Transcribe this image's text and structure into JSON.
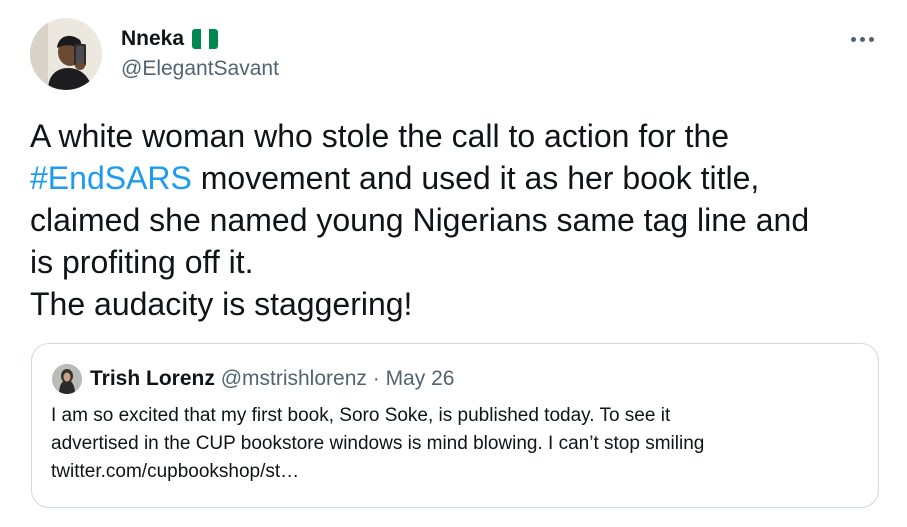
{
  "author": {
    "name": "Nneka",
    "handle": "@ElegantSavant",
    "flag": "nigeria-flag-icon"
  },
  "tweet": {
    "line1": "A white woman who stole the call to action for the",
    "hashtag": "#EndSARS",
    "line2_rest": " movement and used it as her book title,",
    "line3": "claimed she named young Nigerians same tag line and",
    "line4": "is profiting off it.",
    "line5": "The audacity is staggering!"
  },
  "quote": {
    "name": "Trish Lorenz",
    "handle": "@mstrishlorenz",
    "separator": " · ",
    "date": "May 26",
    "line1": "I am so excited that my first book, Soro Soke, is published today. To see it",
    "line2": "advertised in the CUP bookstore windows is mind blowing. I can’t stop smiling",
    "line3": "twitter.com/cupbookshop/st…"
  },
  "colors": {
    "text": "#0f1419",
    "secondary": "#536471",
    "link": "#1d9bf0",
    "border": "#cfd9de",
    "flag_green": "#008751",
    "flag_white": "#ffffff"
  },
  "icons": {
    "more": "more-horizontal-icon"
  }
}
